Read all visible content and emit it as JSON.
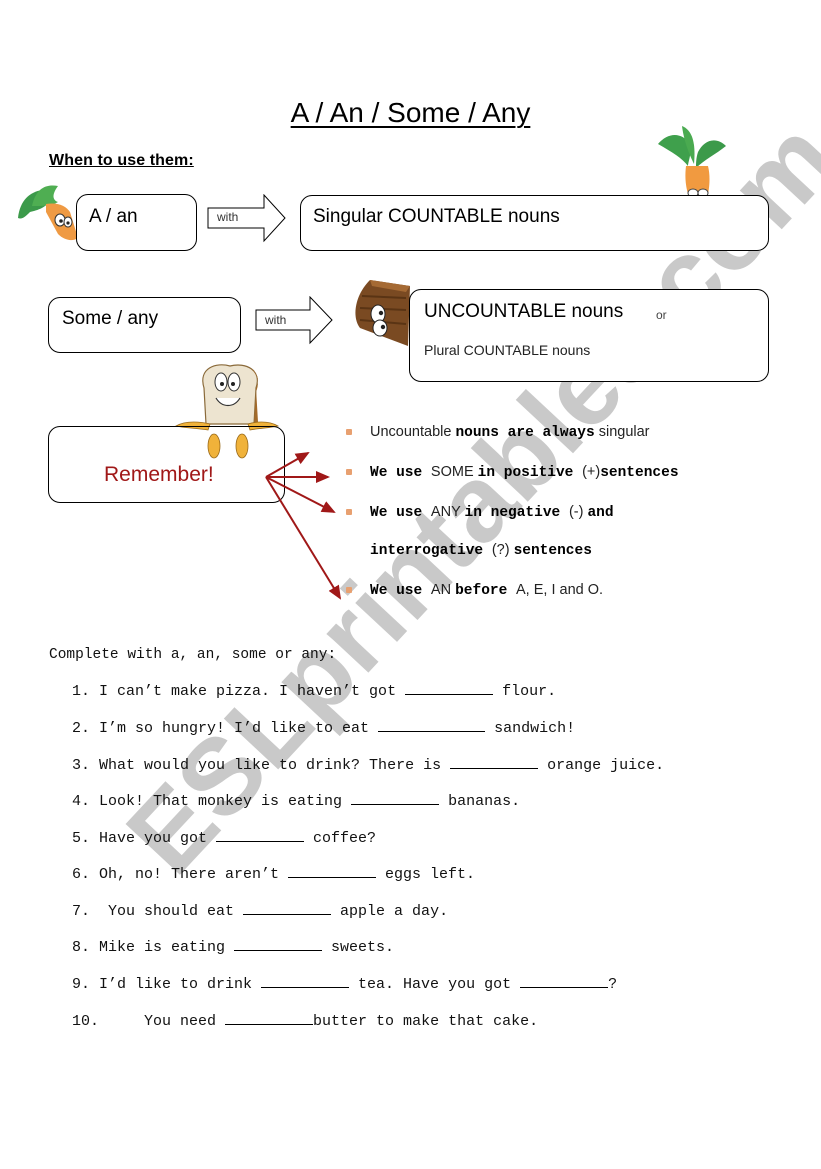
{
  "worksheet": {
    "title": "A / An / Some / Any",
    "subtitle": "When to use them:"
  },
  "usage": {
    "a_an": {
      "label": "A / an",
      "connector": "with",
      "target": "Singular COUNTABLE nouns"
    },
    "some_any": {
      "label": "Some / any",
      "connector": "with",
      "target_main": "UNCOUNTABLE nouns",
      "target_or": "or",
      "target_secondary": "Plural COUNTABLE nouns"
    }
  },
  "remember": {
    "label": "Remember!",
    "color": "#a01818",
    "rules": [
      {
        "parts": [
          {
            "t": "Uncountable ",
            "s": "sans"
          },
          {
            "t": "nouns are always",
            "s": "bold"
          },
          {
            "t": "  singular",
            "s": "sans"
          }
        ]
      },
      {
        "parts": [
          {
            "t": "We use ",
            "s": "bold"
          },
          {
            "t": "SOME ",
            "s": "sans"
          },
          {
            "t": "in positive ",
            "s": "bold"
          },
          {
            "t": "(+)",
            "s": "sans"
          },
          {
            "t": "sentences",
            "s": "bold"
          }
        ]
      },
      {
        "parts": [
          {
            "t": "We use ",
            "s": "bold"
          },
          {
            "t": "ANY ",
            "s": "sans"
          },
          {
            "t": "in negative ",
            "s": "bold"
          },
          {
            "t": "(-) ",
            "s": "sans"
          },
          {
            "t": "and",
            "s": "bold"
          }
        ]
      },
      {
        "parts": [
          {
            "t": "We use ",
            "s": "bold"
          },
          {
            "t": "AN ",
            "s": "sans"
          },
          {
            "t": "before ",
            "s": "bold"
          },
          {
            "t": "A, E, I and O.",
            "s": "sans"
          }
        ]
      }
    ],
    "rule3_continuation": [
      {
        "t": "interrogative ",
        "s": "bold"
      },
      {
        "t": "(?) ",
        "s": "sans"
      },
      {
        "t": "sentences",
        "s": "bold"
      }
    ],
    "bullet_color": "#e8a070"
  },
  "exercise": {
    "instruction": "Complete with a, an, some or any:",
    "items": [
      {
        "num": "1.",
        "segments": [
          "I can’t make pizza. I haven’t got ",
          "_",
          " flour."
        ]
      },
      {
        "num": "2.",
        "segments": [
          "I’m so hungry! I’d like to eat ",
          "_L",
          " sandwich!"
        ]
      },
      {
        "num": "3.",
        "segments": [
          "What would you like to drink? There is ",
          "_",
          " orange juice."
        ]
      },
      {
        "num": "4.",
        "segments": [
          "Look! That monkey is eating ",
          "_",
          " bananas."
        ]
      },
      {
        "num": "5.",
        "segments": [
          "Have you got ",
          "_",
          " coffee?"
        ]
      },
      {
        "num": "6.",
        "segments": [
          "Oh, no! There aren’t ",
          "_",
          " eggs left."
        ]
      },
      {
        "num": "7.",
        "segments": [
          " You should eat ",
          "_",
          " apple a day."
        ]
      },
      {
        "num": "8.",
        "segments": [
          "Mike is eating ",
          "_",
          " sweets."
        ]
      },
      {
        "num": "9.",
        "segments": [
          "I’d like to drink ",
          "_",
          " tea. Have you got ",
          "_",
          "?"
        ]
      },
      {
        "num": "10.",
        "segments": [
          "    You need ",
          "_",
          "butter to make that cake."
        ]
      }
    ]
  },
  "watermark": {
    "text": "ESLprintables.com",
    "color": "#c8c8c8"
  },
  "illustrations": [
    "carrot-left",
    "carrot-right",
    "chocolate-cake",
    "bread-slice"
  ]
}
